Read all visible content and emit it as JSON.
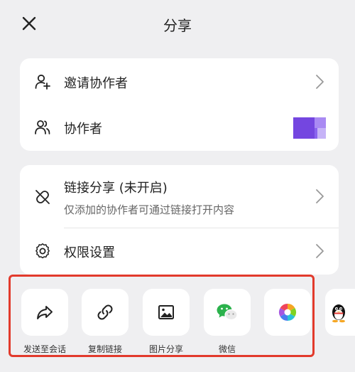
{
  "header": {
    "title": "分享",
    "close_icon": "close-icon"
  },
  "collab_card": {
    "invite_label": "邀请协作者",
    "collaborators_label": "协作者"
  },
  "link_card": {
    "link_share_label": "链接分享 (未开启)",
    "link_share_desc": "仅添加的协作者可通过链接打开内容",
    "permission_label": "权限设置"
  },
  "share_targets": [
    {
      "label": "发送至会话",
      "icon": "forward-arrow-icon"
    },
    {
      "label": "复制链接",
      "icon": "link-icon"
    },
    {
      "label": "图片分享",
      "icon": "image-icon"
    },
    {
      "label": "微信",
      "icon": "wechat-icon"
    },
    {
      "label": "",
      "icon": "photos-icon"
    },
    {
      "label": "",
      "icon": "qq-penguin-icon"
    }
  ],
  "colors": {
    "highlight_border": "#e23a2c",
    "wechat_green": "#2bb24c",
    "avatar_purple": "#7b55e6"
  }
}
